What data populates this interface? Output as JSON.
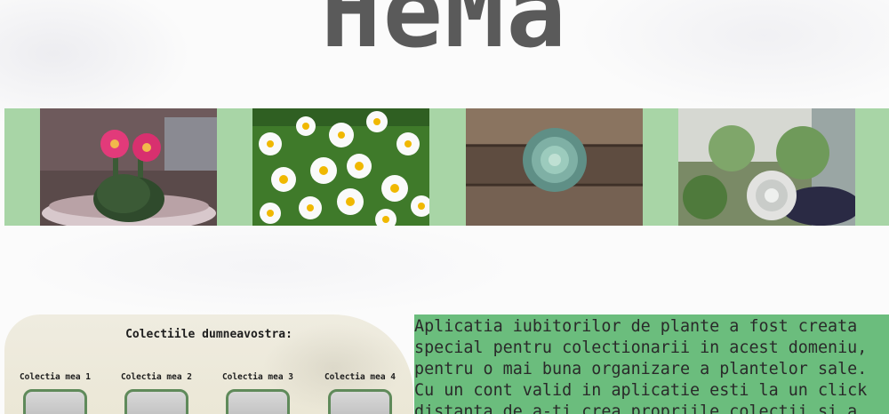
{
  "header": {
    "logo_text": "HeMa"
  },
  "gallery": {
    "background": "#a8d5a6",
    "images": [
      {
        "name": "flowering-cactus-image"
      },
      {
        "name": "daisies-image"
      },
      {
        "name": "succulent-on-wood-image"
      },
      {
        "name": "succulent-arrangement-image"
      }
    ]
  },
  "collections": {
    "title": "Colectiile dumneavostra:",
    "items": [
      {
        "label": "Colectia mea 1"
      },
      {
        "label": "Colectia mea 2"
      },
      {
        "label": "Colectia mea 3"
      },
      {
        "label": "Colectia mea 4"
      }
    ]
  },
  "info": {
    "text": "Aplicatia iubitorilor de plante a fost creata special pentru colectionarii in acest domeniu, pentru o mai buna organizare a plantelor sale. Cu un cont valid in aplicatie esti la un click distanta de a-ti crea propriile colectii si a"
  },
  "colors": {
    "accent_green": "#6bbd7d",
    "strip_green": "#a8d5a6",
    "logo_gray": "#5a5a5a"
  }
}
